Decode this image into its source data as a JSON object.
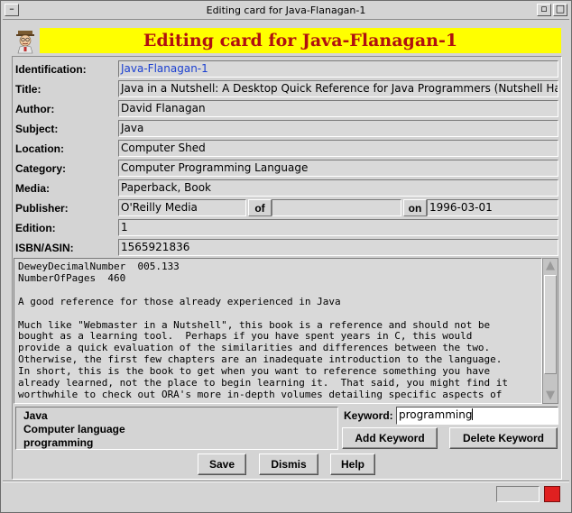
{
  "window": {
    "title": "Editing card for Java-Flanagan-1"
  },
  "header": {
    "banner_text": "Editing card for Java-Flanagan-1",
    "banner_color": "#ffff00",
    "banner_text_color": "#b01010",
    "icon": "librarian-avatar-icon"
  },
  "fields": {
    "identification": {
      "label": "Identification:",
      "value": "Java-Flanagan-1"
    },
    "title": {
      "label": "Title:",
      "value": "Java in a Nutshell: A Desktop Quick Reference for Java Programmers (Nutshell Handb"
    },
    "author": {
      "label": "Author:",
      "value": "David Flanagan"
    },
    "subject": {
      "label": "Subject:",
      "value": "Java"
    },
    "location": {
      "label": "Location:",
      "value": "Computer Shed"
    },
    "category": {
      "label": "Category:",
      "value": "Computer Programming Language"
    },
    "media": {
      "label": "Media:",
      "value": "Paperback, Book"
    },
    "publisher": {
      "label": "Publisher:",
      "value": "O'Reilly Media",
      "of_label": "of",
      "of_value": "",
      "on_label": "on",
      "on_value": "1996-03-01"
    },
    "edition": {
      "label": "Edition:",
      "value": "1"
    },
    "isbn": {
      "label": "ISBN/ASIN:",
      "value": "1565921836"
    }
  },
  "notes": {
    "text": "DeweyDecimalNumber  005.133\nNumberOfPages  460\n\nA good reference for those already experienced in Java\n\nMuch like \"Webmaster in a Nutshell\", this book is a reference and should not be\nbought as a learning tool.  Perhaps if you have spent years in C, this would\nprovide a quick evaluation of the similarities and differences between the two.\nOtherwise, the first few chapters are an inadequate introduction to the language.\nIn short, this is the book to get when you want to reference something you have\nalready learned, not the place to begin learning it.  That said, you might find it\nworthwhile to check out ORA's more in-depth volumes detailing specific aspects of"
  },
  "keywords": {
    "list": [
      "Java",
      "Computer language",
      "programming"
    ],
    "label": "Keyword:",
    "input_value": "programming",
    "add_label": "Add Keyword",
    "delete_label": "Delete Keyword"
  },
  "buttons": {
    "save": "Save",
    "dismiss": "Dismis",
    "help": "Help"
  },
  "status": {
    "indicator_color": "#e02020"
  }
}
